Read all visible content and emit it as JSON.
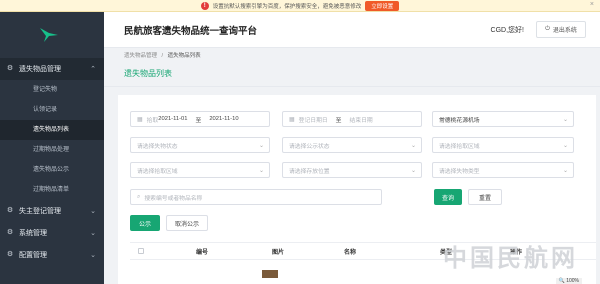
{
  "notice": {
    "text": "设置抗默认搜索引擎为百度，保护搜索安全，避免被恶意修改",
    "button": "立即设置"
  },
  "sidebar": {
    "groups": [
      {
        "label": "遗失物品管理",
        "expanded": true
      },
      {
        "label": "失主登记管理"
      },
      {
        "label": "系统管理"
      },
      {
        "label": "配置管理"
      }
    ],
    "items": [
      "登记失物",
      "认领记录",
      "遗失物品列表",
      "过期物品处理",
      "遗失物品公示",
      "过期物品清单"
    ]
  },
  "header": {
    "title": "民航旅客遗失物品统一查询平台",
    "user": "CGD,您好!",
    "logout": "退出系统"
  },
  "breadcrumb": {
    "parent": "遗失物品管理",
    "separator": "/",
    "current": "遗失物品列表"
  },
  "page_title": "遗失物品列表",
  "filters": {
    "date_from_label": "拾取",
    "date_from": "2021-11-01",
    "to": "至",
    "date_to": "2021-11-10",
    "reg_from": "登记日期日",
    "reg_to": "结束日期",
    "airport": "常德桃花源机场",
    "pickup_status": "请选择失物状态",
    "notice_status": "请选择公示状态",
    "pickup_place": "请选择拾取区域",
    "pickup_area": "请选择拾取区域",
    "storage_status": "请选择存放位置",
    "item_type": "请选择失物类型",
    "search_placeholder": "搜索编号或者物品名称"
  },
  "buttons": {
    "query": "查询",
    "reset": "重置",
    "publish": "公示",
    "cancel_publish": "取消公示"
  },
  "table": {
    "columns": [
      "编号",
      "图片",
      "名称",
      "类型",
      "操作"
    ]
  },
  "watermark": "中国民航网",
  "zoom": "100%"
}
